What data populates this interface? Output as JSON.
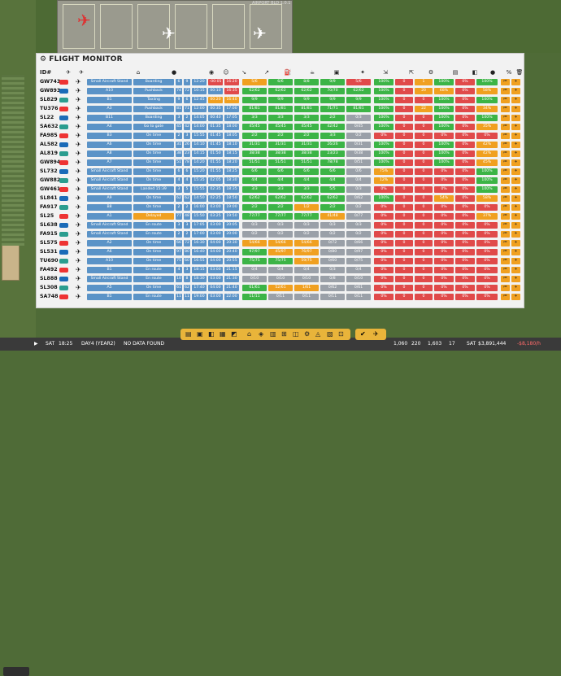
{
  "top_caption": "AIRPORT BLD 1.0.1",
  "panel": {
    "title": "FLIGHT MONITOR"
  },
  "header": {
    "id_label": "ID#",
    "icons": [
      "airline-icon",
      "aircraft-icon",
      "stand-icon",
      "status-icon",
      "gate-icon",
      "passengers-icon",
      "arrival-icon",
      "departure-icon",
      "fuel-icon",
      "catering-icon",
      "baggage-icon",
      "cleaning-icon",
      "deboard-icon",
      "board-icon",
      "settings-icon",
      "luggage-icon",
      "shop-icon",
      "water-icon",
      "percent-icon",
      "food-icon",
      "trash-icon"
    ]
  },
  "flights": [
    {
      "id": "GW743",
      "type": "Small",
      "stand": "Small Aircraft Stand",
      "status": "Boarding",
      "st": "blue",
      "a": "6",
      "b": "9",
      "t1": "12:20",
      "t2": "-00:05",
      "t3": "16:20",
      "t2c": "red",
      "t3c": "red",
      "p1": "5/6",
      "p2": "6/6",
      "p3": "8/8",
      "p4": "9/9",
      "p5": "5/6",
      "p5c": "red",
      "q1": "100%",
      "q2": "0",
      "q3": "1",
      "q4": "100%",
      "q5": "0%",
      "q6": "100%"
    },
    {
      "id": "GW893",
      "type": "A",
      "stand": "A10",
      "status": "Pushback",
      "st": "blue",
      "a": "74",
      "b": "72",
      "t1": "10:15",
      "t2": "00:10",
      "t3": "16:35",
      "t2c": "blue",
      "t3c": "red",
      "p1": "62/62",
      "p2": "62/62",
      "p3": "62/62",
      "p4": "70/70",
      "p5": "62/62",
      "p5c": "green",
      "q1": "100%",
      "q2": "0",
      "q3": "20",
      "q4": "68%",
      "q5": "0%",
      "q6": "58%"
    },
    {
      "id": "SL829",
      "type": "B",
      "stand": "B1",
      "status": "Taxiing",
      "st": "blue",
      "a": "9",
      "b": "6",
      "t1": "12:45",
      "t2": "00:20",
      "t3": "16:40",
      "t2c": "orange",
      "t3c": "orange",
      "p1": "9/9",
      "p2": "9/9",
      "p3": "9/9",
      "p4": "9/9",
      "p5": "9/9",
      "p5c": "green",
      "q1": "100%",
      "q2": "0",
      "q3": "0",
      "q4": "100%",
      "q5": "0%",
      "q6": "100%"
    },
    {
      "id": "TU376",
      "type": "A",
      "stand": "A3",
      "status": "Pushback",
      "st": "blue",
      "a": "81",
      "b": "71",
      "t1": "12:00",
      "t2": "00:35",
      "t3": "17:00",
      "t2c": "blue",
      "t3c": "blue",
      "p1": "81/81",
      "p2": "81/81",
      "p3": "81/81",
      "p4": "71/71",
      "p5": "81/81",
      "p5c": "green",
      "q1": "100%",
      "q2": "0",
      "q3": "22",
      "q4": "100%",
      "q5": "0%",
      "q6": "34%"
    },
    {
      "id": "SL22",
      "type": "B",
      "stand": "B11",
      "status": "Boarding",
      "st": "blue",
      "a": "3",
      "b": "2",
      "t1": "14:05",
      "t2": "00:40",
      "t3": "17:05",
      "t2c": "blue",
      "t3c": "blue",
      "p1": "3/3",
      "p2": "3/3",
      "p3": "3/3",
      "p4": "2/2",
      "p5": "0/3",
      "p5c": "gray",
      "q1": "100%",
      "q2": "0",
      "q3": "0",
      "q4": "100%",
      "q5": "0%",
      "q6": "100%"
    },
    {
      "id": "SA632",
      "type": "A",
      "stand": "A4",
      "status": "Go to gate",
      "st": "blue",
      "a": "45",
      "b": "42",
      "t1": "14:00",
      "t2": "01:35",
      "t3": "18:00",
      "t2c": "blue",
      "t3c": "blue",
      "p1": "45/45",
      "p2": "45/45",
      "p3": "45/45",
      "p4": "42/42",
      "p5": "0/45",
      "p5c": "gray",
      "q1": "100%",
      "q2": "0",
      "q3": "0",
      "q4": "100%",
      "q5": "0%",
      "q6": "35%"
    },
    {
      "id": "FA985",
      "type": "B",
      "stand": "B3",
      "status": "On time",
      "st": "blue",
      "a": "2",
      "b": "3",
      "t1": "15:55",
      "t2": "01:45",
      "t3": "18:05",
      "t2c": "blue",
      "t3c": "blue",
      "p1": "2/2",
      "p2": "2/2",
      "p3": "2/2",
      "p4": "3/3",
      "p5": "0/2",
      "p5c": "gray",
      "q1": "0%",
      "q2": "0",
      "q3": "0",
      "q4": "0%",
      "q5": "0%",
      "q6": "0%"
    },
    {
      "id": "AL582",
      "type": "A",
      "stand": "A6",
      "status": "On time",
      "st": "blue",
      "a": "31",
      "b": "26",
      "t1": "14:10",
      "t2": "01:45",
      "t3": "18:10",
      "t2c": "blue",
      "t3c": "blue",
      "p1": "31/31",
      "p2": "31/31",
      "p3": "31/31",
      "p4": "26/26",
      "p5": "0/31",
      "p5c": "gray",
      "q1": "100%",
      "q2": "0",
      "q3": "0",
      "q4": "100%",
      "q5": "0%",
      "q6": "42%"
    },
    {
      "id": "AL819",
      "type": "A",
      "stand": "A8",
      "status": "On time",
      "st": "blue",
      "a": "38",
      "b": "23",
      "t1": "14:15",
      "t2": "01:50",
      "t3": "18:15",
      "t2c": "blue",
      "t3c": "blue",
      "p1": "38/38",
      "p2": "38/38",
      "p3": "38/38",
      "p4": "23/23",
      "p5": "0/38",
      "p5c": "gray",
      "q1": "100%",
      "q2": "0",
      "q3": "0",
      "q4": "100%",
      "q5": "0%",
      "q6": "42%"
    },
    {
      "id": "GW894",
      "type": "A",
      "stand": "A7",
      "status": "On time",
      "st": "blue",
      "a": "51",
      "b": "78",
      "t1": "14:20",
      "t2": "01:55",
      "t3": "18:20",
      "t2c": "blue",
      "t3c": "blue",
      "p1": "51/51",
      "p2": "51/51",
      "p3": "51/51",
      "p4": "78/78",
      "p5": "0/51",
      "p5c": "gray",
      "q1": "100%",
      "q2": "0",
      "q3": "0",
      "q4": "100%",
      "q5": "0%",
      "q6": "45%"
    },
    {
      "id": "SL732",
      "type": "Small",
      "stand": "Small Aircraft Stand",
      "status": "On time",
      "st": "blue",
      "a": "6",
      "b": "6",
      "t1": "15:20",
      "t2": "01:55",
      "t3": "18:25",
      "t2c": "blue",
      "t3c": "blue",
      "p1": "6/6",
      "p2": "6/6",
      "p3": "6/6",
      "p4": "6/6",
      "p5": "0/6",
      "p5c": "gray",
      "q1": "75%",
      "q2": "0",
      "q3": "0",
      "q4": "0%",
      "q5": "0%",
      "q6": "100%"
    },
    {
      "id": "GW882",
      "type": "Small",
      "stand": "Small Aircraft Stand",
      "status": "On time",
      "st": "blue",
      "a": "4",
      "b": "4",
      "t1": "15:35",
      "t2": "02:05",
      "t3": "18:30",
      "t2c": "blue",
      "t3c": "blue",
      "p1": "4/4",
      "p2": "4/4",
      "p3": "4/4",
      "p4": "4/4",
      "p5": "0/4",
      "p5c": "gray",
      "q1": "12%",
      "q2": "0",
      "q3": "0",
      "q4": "0%",
      "q5": "0%",
      "q6": "100%"
    },
    {
      "id": "GW461",
      "type": "Small",
      "stand": "Small Aircraft Stand",
      "status": "Landed 15:39",
      "st": "blue",
      "a": "3",
      "b": "5",
      "t1": "15:55",
      "t2": "02:35",
      "t3": "18:35",
      "t2c": "blue",
      "t3c": "blue",
      "p1": "3/3",
      "p2": "3/3",
      "p3": "3/3",
      "p4": "5/5",
      "p5": "0/3",
      "p5c": "gray",
      "q1": "0%",
      "q2": "0",
      "q3": "0",
      "q4": "0%",
      "q5": "0%",
      "q6": "100%"
    },
    {
      "id": "SL841",
      "type": "A",
      "stand": "A9",
      "status": "On time",
      "st": "blue",
      "a": "62",
      "b": "62",
      "t1": "14:50",
      "t2": "02:25",
      "t3": "18:50",
      "t2c": "blue",
      "t3c": "blue",
      "p1": "62/62",
      "p2": "62/62",
      "p3": "62/62",
      "p4": "62/62",
      "p5": "0/62",
      "p5c": "gray",
      "q1": "100%",
      "q2": "0",
      "q3": "0",
      "q4": "54%",
      "q5": "0%",
      "q6": "58%"
    },
    {
      "id": "FA917",
      "type": "B",
      "stand": "B8",
      "status": "On time",
      "st": "blue",
      "a": "2",
      "b": "2",
      "t1": "16:00",
      "t2": "03:00",
      "t3": "19:00",
      "t2c": "blue",
      "t3c": "blue",
      "p1": "2/2",
      "p2": "2/2",
      "p3": "1/2",
      "p4": "2/2",
      "p5": "0/2",
      "p5c": "gray",
      "q1": "0%",
      "q2": "0",
      "q3": "0",
      "q4": "0%",
      "q5": "0%",
      "q6": "0%"
    },
    {
      "id": "SL25",
      "type": "A",
      "stand": "A1",
      "status": "Delayed",
      "st": "orange",
      "a": "77",
      "b": "48",
      "t1": "15:50",
      "t2": "03:25",
      "t3": "19:50",
      "t2c": "blue",
      "t3c": "blue",
      "p1": "77/77",
      "p2": "77/77",
      "p3": "77/77",
      "p4": "41/48",
      "p5": "0/77",
      "p5c": "gray",
      "q1": "0%",
      "q2": "0",
      "q3": "0",
      "q4": "0%",
      "q5": "0%",
      "q6": "37%"
    },
    {
      "id": "SL638",
      "type": "Small",
      "stand": "Small Aircraft Stand",
      "status": "En route",
      "st": "blue",
      "a": "3",
      "b": "3",
      "t1": "17:05",
      "t2": "03:00",
      "t3": "20:05",
      "t2c": "blue",
      "t3c": "blue",
      "p1": "0/3",
      "p2": "0/3",
      "p3": "0/3",
      "p4": "0/3",
      "p5": "0/3",
      "p5c": "gray",
      "q1": "0%",
      "q2": "0",
      "q3": "0",
      "q4": "0%",
      "q5": "0%",
      "q6": "0%"
    },
    {
      "id": "FA915",
      "type": "Small",
      "stand": "Small Aircraft Stand",
      "status": "En route",
      "st": "blue",
      "a": "2",
      "b": "2",
      "t1": "17:00",
      "t2": "03:00",
      "t3": "20:00",
      "t2c": "blue",
      "t3c": "blue",
      "p1": "0/2",
      "p2": "0/2",
      "p3": "0/2",
      "p4": "0/2",
      "p5": "0/2",
      "p5c": "gray",
      "q1": "0%",
      "q2": "0",
      "q3": "0",
      "q4": "0%",
      "q5": "0%",
      "q6": "0%"
    },
    {
      "id": "SL575",
      "type": "A",
      "stand": "A2",
      "status": "On time",
      "st": "blue",
      "a": "66",
      "b": "72",
      "t1": "16:30",
      "t2": "04:00",
      "t3": "20:30",
      "t2c": "blue",
      "t3c": "blue",
      "p1": "54/66",
      "p2": "54/66",
      "p3": "54/66",
      "p4": "0/72",
      "p5": "0/66",
      "p5c": "gray",
      "q1": "0%",
      "q2": "0",
      "q3": "0",
      "q4": "0%",
      "q5": "0%",
      "q6": "0%"
    },
    {
      "id": "SL531",
      "type": "A",
      "stand": "A6",
      "status": "On time",
      "st": "blue",
      "a": "97",
      "b": "80",
      "t1": "16:40",
      "t2": "04:00",
      "t3": "20:40",
      "t2c": "blue",
      "t3c": "blue",
      "p1": "97/97",
      "p2": "45/97",
      "p3": "76/97",
      "p4": "0/80",
      "p5": "0/97",
      "p5c": "gray",
      "q1": "0%",
      "q2": "0",
      "q3": "0",
      "q4": "0%",
      "q5": "0%",
      "q6": "0%"
    },
    {
      "id": "TU690",
      "type": "A",
      "stand": "A10",
      "status": "On time",
      "st": "blue",
      "a": "75",
      "b": "60",
      "t1": "16:55",
      "t2": "04:00",
      "t3": "20:55",
      "t2c": "blue",
      "t3c": "blue",
      "p1": "75/75",
      "p2": "75/75",
      "p3": "59/75",
      "p4": "0/60",
      "p5": "0/75",
      "p5c": "gray",
      "q1": "0%",
      "q2": "0",
      "q3": "0",
      "q4": "0%",
      "q5": "0%",
      "q6": "0%"
    },
    {
      "id": "FA492",
      "type": "B",
      "stand": "B1",
      "status": "En route",
      "st": "blue",
      "a": "4",
      "b": "3",
      "t1": "18:15",
      "t2": "03:00",
      "t3": "21:15",
      "t2c": "blue",
      "t3c": "blue",
      "p1": "0/4",
      "p2": "0/4",
      "p3": "0/4",
      "p4": "0/3",
      "p5": "0/4",
      "p5c": "gray",
      "q1": "0%",
      "q2": "0",
      "q3": "0",
      "q4": "0%",
      "q5": "0%",
      "q6": "0%"
    },
    {
      "id": "SL888",
      "type": "Small",
      "stand": "Small Aircraft Stand",
      "status": "En route",
      "st": "blue",
      "a": "10",
      "b": "8",
      "t1": "18:30",
      "t2": "03:00",
      "t3": "21:30",
      "t2c": "blue",
      "t3c": "blue",
      "p1": "0/10",
      "p2": "0/10",
      "p3": "0/10",
      "p4": "0/8",
      "p5": "0/10",
      "p5c": "gray",
      "q1": "0%",
      "q2": "0",
      "q3": "0",
      "q4": "0%",
      "q5": "0%",
      "q6": "0%"
    },
    {
      "id": "SL308",
      "type": "A",
      "stand": "A5",
      "status": "On time",
      "st": "blue",
      "a": "61",
      "b": "62",
      "t1": "17:40",
      "t2": "04:00",
      "t3": "21:40",
      "t2c": "blue",
      "t3c": "blue",
      "p1": "61/61",
      "p2": "52/61",
      "p3": "1/61",
      "p4": "0/62",
      "p5": "0/61",
      "p5c": "gray",
      "q1": "0%",
      "q2": "0",
      "q3": "0",
      "q4": "0%",
      "q5": "0%",
      "q6": "0%"
    },
    {
      "id": "SA748",
      "type": "B",
      "stand": "B1",
      "status": "En route",
      "st": "blue",
      "a": "11",
      "b": "11",
      "t1": "19:00",
      "t2": "03:00",
      "t3": "22:00",
      "t2c": "blue",
      "t3c": "blue",
      "p1": "11/11",
      "p2": "0/11",
      "p3": "0/11",
      "p4": "0/11",
      "p5": "0/11",
      "p5c": "gray",
      "q1": "0%",
      "q2": "0",
      "q3": "0",
      "q4": "0%",
      "q5": "0%",
      "q6": "0%"
    }
  ],
  "bottom": {
    "day": "SAT",
    "time": "18:25",
    "day_year": "DAY4 (YEAR2)",
    "data": "NO DATA FOUND",
    "c1": "1,060",
    "c2": "220",
    "c3": "1,603",
    "c4": "17",
    "money_label": "SAT",
    "money": "$3,891,444",
    "rate": "-$8,180/h"
  }
}
